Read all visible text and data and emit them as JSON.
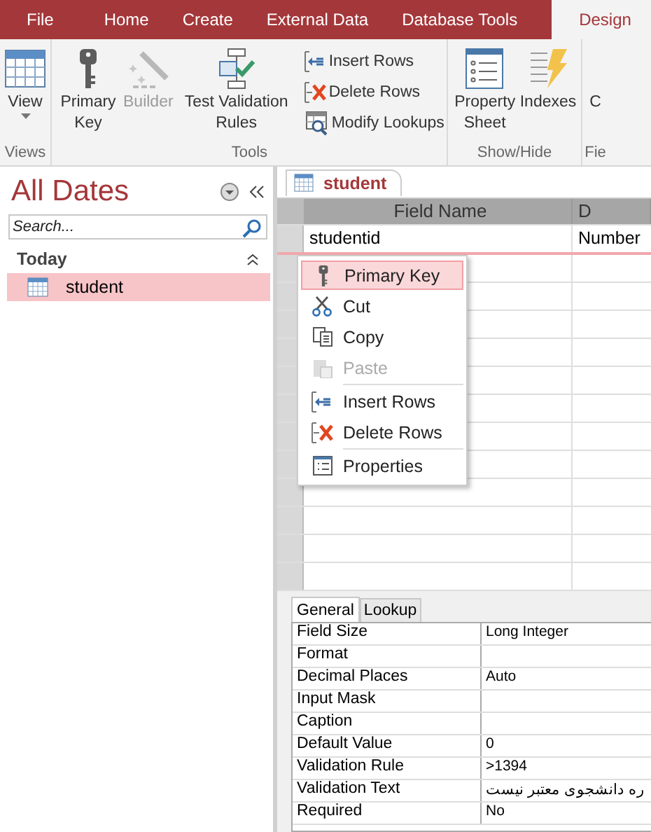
{
  "ribbon_tabs": [
    {
      "label": "File",
      "selected": false
    },
    {
      "label": "Home",
      "selected": false
    },
    {
      "label": "Create",
      "selected": false
    },
    {
      "label": "External Data",
      "selected": false
    },
    {
      "label": "Database Tools",
      "selected": false
    },
    {
      "label": "Design",
      "selected": true
    }
  ],
  "ribbon_groups": [
    {
      "label": "Views",
      "buttons": [
        {
          "kind": "large",
          "label": "View",
          "dropdown": true,
          "disabled": false
        }
      ]
    },
    {
      "label": "Tools",
      "buttons": [
        {
          "kind": "large",
          "label": "Primary Key",
          "dropdown": false,
          "disabled": false
        },
        {
          "kind": "large",
          "label": "Builder",
          "dropdown": false,
          "disabled": true
        },
        {
          "kind": "large",
          "label": "Test Validation Rules",
          "dropdown": false,
          "disabled": false
        },
        {
          "kind": "small",
          "label": "Insert Rows",
          "dropdown": false,
          "disabled": false
        },
        {
          "kind": "small",
          "label": "Delete Rows",
          "dropdown": false,
          "disabled": false
        },
        {
          "kind": "small",
          "label": "Modify Lookups",
          "dropdown": false,
          "disabled": false
        }
      ]
    },
    {
      "label": "Show/Hide",
      "buttons": [
        {
          "kind": "large",
          "label": "Property Sheet",
          "dropdown": false,
          "disabled": false
        },
        {
          "kind": "large",
          "label": "Indexes",
          "dropdown": false,
          "disabled": false
        }
      ]
    },
    {
      "label": "Fie",
      "buttons": [
        {
          "kind": "large",
          "label": "C"
        }
      ]
    }
  ],
  "nav_pane": {
    "title": "All Dates",
    "search": {
      "placeholder": "Search..."
    },
    "groups": [
      {
        "label": "Today",
        "expanded": true,
        "items": [
          {
            "label": "student",
            "selected": true
          }
        ]
      }
    ]
  },
  "document_tab": {
    "label": "student"
  },
  "design_grid": {
    "columns": [
      "Field Name",
      "D"
    ],
    "rows": [
      [
        "studentid",
        "Number"
      ]
    ]
  },
  "context_menu": [
    {
      "kind": "item",
      "label": "Primary Key",
      "selected": true,
      "disabled": false
    },
    {
      "kind": "item",
      "label": "Cut",
      "selected": false,
      "disabled": false
    },
    {
      "kind": "item",
      "label": "Copy",
      "selected": false,
      "disabled": false
    },
    {
      "kind": "item",
      "label": "Paste",
      "selected": false,
      "disabled": true
    },
    {
      "kind": "separator"
    },
    {
      "kind": "item",
      "label": "Insert Rows",
      "selected": false,
      "disabled": false
    },
    {
      "kind": "item",
      "label": "Delete Rows",
      "selected": false,
      "disabled": false
    },
    {
      "kind": "separator"
    },
    {
      "kind": "item",
      "label": "Properties",
      "selected": false,
      "disabled": false
    }
  ],
  "field_properties": {
    "tabs": [
      {
        "label": "General",
        "selected": true
      },
      {
        "label": "Lookup",
        "selected": false
      }
    ],
    "rows": [
      {
        "label": "Field Size",
        "value": "Long Integer"
      },
      {
        "label": "Format"
      },
      {
        "label": "Decimal Places",
        "value": "Auto"
      },
      {
        "label": "Input Mask"
      },
      {
        "label": "Caption"
      },
      {
        "label": "Default Value",
        "value": "0"
      },
      {
        "label": "Validation Rule",
        "value": ">1394"
      },
      {
        "label": "Validation Text",
        "value": "ره دانشجوی معتبر نیست"
      },
      {
        "label": "Required",
        "value": "No"
      }
    ]
  }
}
